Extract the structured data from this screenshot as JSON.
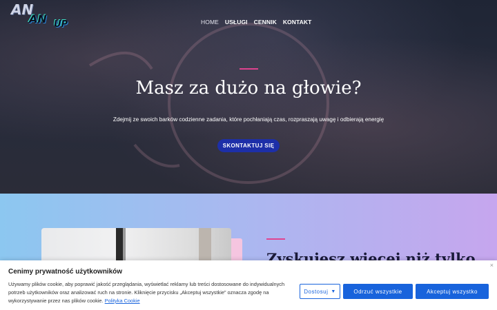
{
  "logo": {
    "line1": "AN",
    "line2": "AN",
    "line3": "UP"
  },
  "nav": {
    "items": [
      "HOME",
      "USŁUGI",
      "CENNIK",
      "KONTAKT"
    ]
  },
  "hero": {
    "title": "Masz za dużo na głowie?",
    "subtitle": "Zdejmij ze swoich barków codzienne zadania, które pochłaniają czas, rozpraszają uwagę i odbierają energię",
    "cta_label": "SKONTAKTUJ SIĘ"
  },
  "section2": {
    "title": "Zyskujesz więcej niż tylko"
  },
  "cookie": {
    "close": "×",
    "title": "Cenimy prywatność użytkowników",
    "text": "Używamy plików cookie, aby poprawić jakość przeglądania, wyświetlać reklamy lub treści dostosowane do indywidualnych potrzeb użytkowników oraz analizować ruch na stronie. Kliknięcie przycisku „Akceptuj wszystkie” oznacza zgodę na wykorzystywanie przez nas plików cookie.",
    "policy_link": "Polityka Cookie",
    "customize_label": "Dostosuj",
    "reject_label": "Odrzuć wszystkie",
    "accept_label": "Akceptuj wszystko"
  },
  "colors": {
    "accent": "#e0438f",
    "cta": "#1d2fa8",
    "cookie_button": "#1863dc"
  }
}
